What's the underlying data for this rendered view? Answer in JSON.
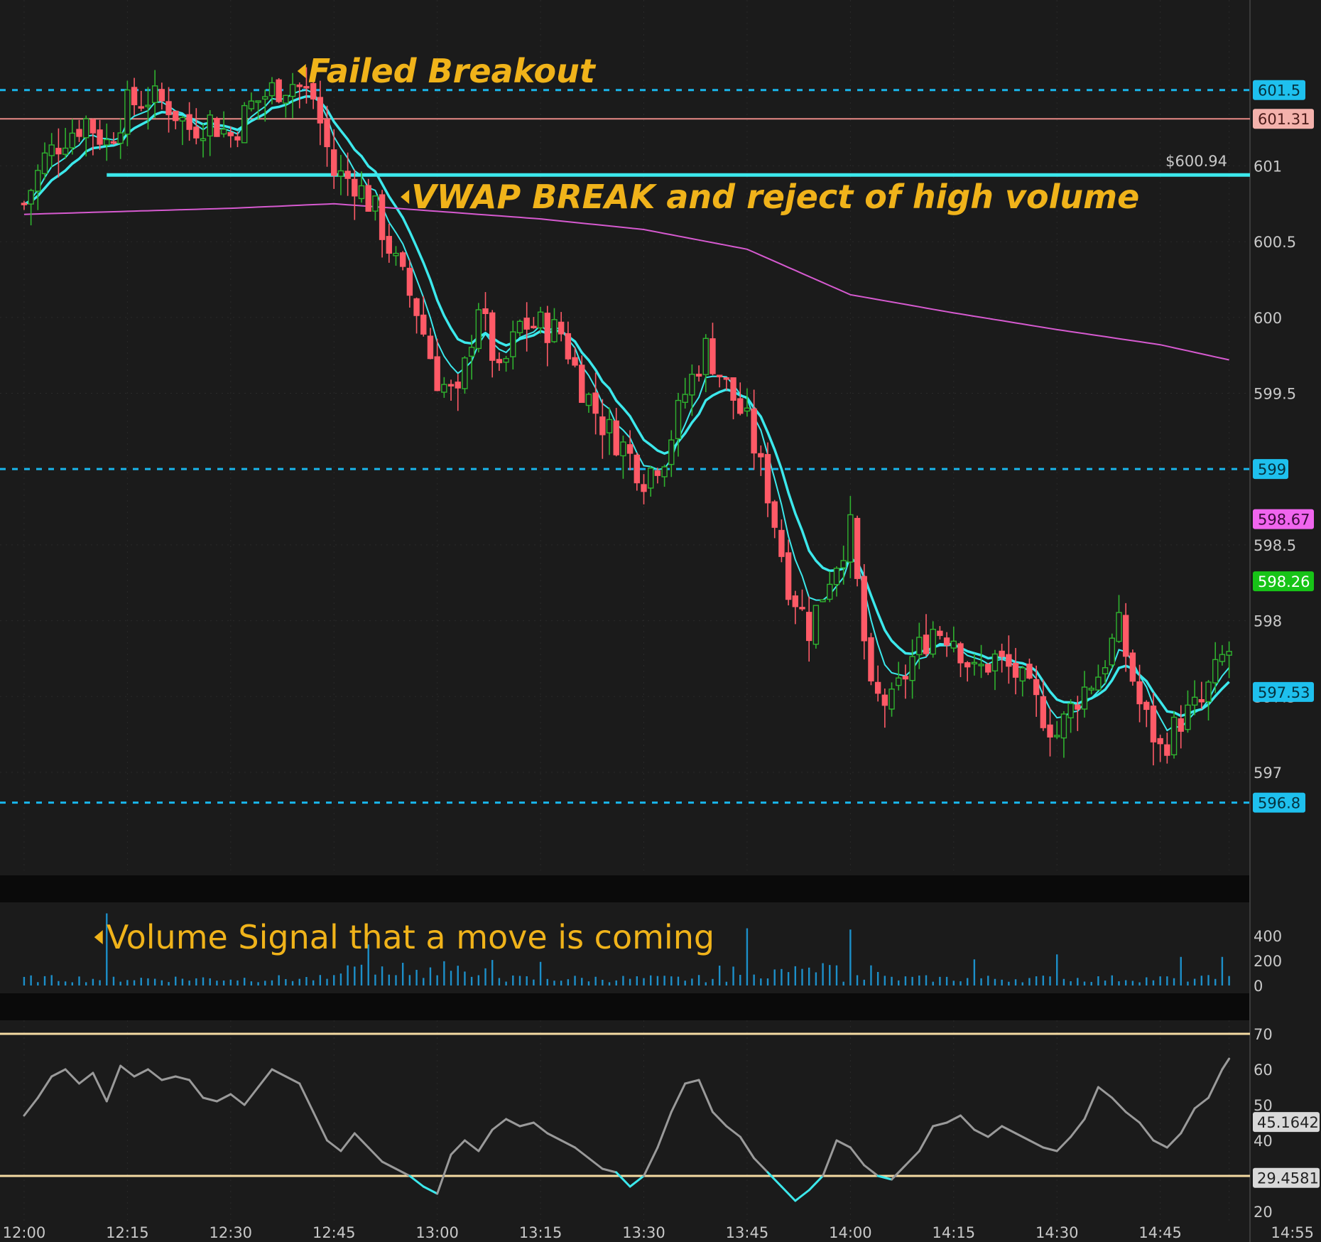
{
  "chart_data": [
    {
      "type": "candlestick",
      "panel": "price",
      "ylim": [
        596.4,
        602.0
      ],
      "y_ticks": [
        "601",
        "600.5",
        "600",
        "599.5",
        "598.5",
        "598",
        "597.5",
        "597"
      ],
      "x_ticks": [
        "12:00",
        "12:15",
        "12:30",
        "12:45",
        "13:00",
        "13:15",
        "13:30",
        "13:45",
        "14:00",
        "14:15",
        "14:30",
        "14:45",
        "14:55"
      ],
      "x_tick_minutes": [
        0,
        15,
        30,
        45,
        60,
        75,
        90,
        105,
        120,
        135,
        150,
        165,
        175
      ],
      "price_levels": [
        {
          "label": "601.5",
          "value": 601.5,
          "style": "dashed",
          "color": "#19b6ec"
        },
        {
          "label": "601.31",
          "value": 601.31,
          "style": "solid",
          "color": "#e98a86"
        },
        {
          "label": "599",
          "value": 599.0,
          "style": "dashed",
          "color": "#19b6ec"
        },
        {
          "label": "596.8",
          "value": 596.8,
          "style": "dashed",
          "color": "#19b6ec"
        }
      ],
      "vwap_line": {
        "label": "$600.94",
        "value": 600.94,
        "color": "#3ce8ec",
        "start_minute": 12
      },
      "price_badges": [
        {
          "label": "598.67",
          "value": 598.67,
          "bg": "#f065ee",
          "fg": "#3a0a3a"
        },
        {
          "label": "598.26",
          "value": 598.26,
          "bg": "#17c317",
          "fg": "#ffffff"
        },
        {
          "label": "597.53",
          "value": 597.53,
          "bg": "#1ec0ee",
          "fg": "#05323f"
        }
      ],
      "annotations": [
        {
          "text": "Failed Breakout",
          "minute": 40,
          "value": 601.55
        },
        {
          "text": "VWAP BREAK and reject of high volume",
          "minute": 55,
          "value": 600.72
        }
      ],
      "close_path": [
        [
          0,
          600.75
        ],
        [
          3,
          601.05
        ],
        [
          6,
          601.2
        ],
        [
          9,
          601.3
        ],
        [
          12,
          601.15
        ],
        [
          15,
          601.4
        ],
        [
          18,
          601.45
        ],
        [
          21,
          601.4
        ],
        [
          24,
          601.25
        ],
        [
          27,
          601.3
        ],
        [
          30,
          601.2
        ],
        [
          33,
          601.4
        ],
        [
          36,
          601.5
        ],
        [
          39,
          601.55
        ],
        [
          42,
          601.45
        ],
        [
          45,
          600.95
        ],
        [
          48,
          600.9
        ],
        [
          51,
          600.7
        ],
        [
          54,
          600.35
        ],
        [
          57,
          600.05
        ],
        [
          60,
          599.6
        ],
        [
          63,
          599.45
        ],
        [
          66,
          600.1
        ],
        [
          69,
          599.6
        ],
        [
          72,
          599.95
        ],
        [
          75,
          599.95
        ],
        [
          78,
          599.9
        ],
        [
          81,
          599.55
        ],
        [
          84,
          599.3
        ],
        [
          87,
          599.15
        ],
        [
          90,
          598.95
        ],
        [
          93,
          599.1
        ],
        [
          96,
          599.5
        ],
        [
          99,
          599.8
        ],
        [
          102,
          599.55
        ],
        [
          105,
          599.3
        ],
        [
          108,
          598.85
        ],
        [
          111,
          598.25
        ],
        [
          114,
          597.95
        ],
        [
          117,
          598.3
        ],
        [
          120,
          598.6
        ],
        [
          123,
          597.5
        ],
        [
          126,
          597.45
        ],
        [
          129,
          597.75
        ],
        [
          132,
          597.95
        ],
        [
          135,
          597.9
        ],
        [
          138,
          597.65
        ],
        [
          141,
          597.75
        ],
        [
          144,
          597.65
        ],
        [
          147,
          597.45
        ],
        [
          150,
          597.25
        ],
        [
          153,
          597.5
        ],
        [
          156,
          597.65
        ],
        [
          159,
          597.95
        ],
        [
          162,
          597.45
        ],
        [
          165,
          597.15
        ],
        [
          168,
          597.35
        ],
        [
          171,
          597.45
        ],
        [
          174,
          597.75
        ],
        [
          175,
          597.8
        ]
      ],
      "ema_fast_color": "#3ce8ec",
      "ema_slow_color": "#3ce8ec",
      "vwap_curve_color": "#d65ad0",
      "vwap_curve": [
        [
          0,
          600.68
        ],
        [
          15,
          600.7
        ],
        [
          30,
          600.72
        ],
        [
          45,
          600.75
        ],
        [
          60,
          600.7
        ],
        [
          75,
          600.65
        ],
        [
          90,
          600.58
        ],
        [
          105,
          600.45
        ],
        [
          120,
          600.15
        ],
        [
          135,
          600.03
        ],
        [
          150,
          599.92
        ],
        [
          165,
          599.82
        ],
        [
          175,
          599.72
        ]
      ]
    },
    {
      "type": "bar",
      "panel": "volume",
      "y_ticks": [
        "400",
        "200",
        "0"
      ],
      "ylim": [
        0,
        600
      ],
      "annotation": "Volume Signal that a move is coming",
      "bar_color": "#1c8fc9",
      "spikes": [
        [
          12,
          580
        ],
        [
          50,
          330
        ],
        [
          75,
          190
        ],
        [
          105,
          460
        ],
        [
          120,
          450
        ],
        [
          138,
          210
        ],
        [
          150,
          250
        ],
        [
          168,
          230
        ],
        [
          174,
          230
        ]
      ]
    },
    {
      "type": "line",
      "panel": "rsi",
      "y_ticks": [
        "70",
        "60",
        "50",
        "40",
        "20"
      ],
      "ylim": [
        18,
        72
      ],
      "overbought": 70,
      "oversold": 30,
      "badges": [
        {
          "label": "45.1642",
          "value": 45.1642
        },
        {
          "label": "29.4581",
          "value": 29.4581
        }
      ],
      "line_color": "#9a9a9a",
      "oversold_color": "#3ce8ec",
      "level_color": "#f5dba3",
      "points": [
        [
          0,
          47
        ],
        [
          2,
          52
        ],
        [
          4,
          58
        ],
        [
          6,
          60
        ],
        [
          8,
          56
        ],
        [
          10,
          59
        ],
        [
          12,
          51
        ],
        [
          14,
          61
        ],
        [
          16,
          58
        ],
        [
          18,
          60
        ],
        [
          20,
          57
        ],
        [
          22,
          58
        ],
        [
          24,
          57
        ],
        [
          26,
          52
        ],
        [
          28,
          51
        ],
        [
          30,
          53
        ],
        [
          32,
          50
        ],
        [
          34,
          55
        ],
        [
          36,
          60
        ],
        [
          38,
          58
        ],
        [
          40,
          56
        ],
        [
          42,
          48
        ],
        [
          44,
          40
        ],
        [
          46,
          37
        ],
        [
          48,
          42
        ],
        [
          50,
          38
        ],
        [
          52,
          34
        ],
        [
          54,
          32
        ],
        [
          56,
          30
        ],
        [
          58,
          27
        ],
        [
          60,
          25
        ],
        [
          62,
          36
        ],
        [
          64,
          40
        ],
        [
          66,
          37
        ],
        [
          68,
          43
        ],
        [
          70,
          46
        ],
        [
          72,
          44
        ],
        [
          74,
          45
        ],
        [
          76,
          42
        ],
        [
          78,
          40
        ],
        [
          80,
          38
        ],
        [
          82,
          35
        ],
        [
          84,
          32
        ],
        [
          86,
          31
        ],
        [
          88,
          27
        ],
        [
          90,
          30
        ],
        [
          92,
          38
        ],
        [
          94,
          48
        ],
        [
          96,
          56
        ],
        [
          98,
          57
        ],
        [
          100,
          48
        ],
        [
          102,
          44
        ],
        [
          104,
          41
        ],
        [
          106,
          35
        ],
        [
          108,
          31
        ],
        [
          110,
          27
        ],
        [
          112,
          23
        ],
        [
          114,
          26
        ],
        [
          116,
          30
        ],
        [
          118,
          40
        ],
        [
          120,
          38
        ],
        [
          122,
          33
        ],
        [
          124,
          30
        ],
        [
          126,
          29
        ],
        [
          128,
          33
        ],
        [
          130,
          37
        ],
        [
          132,
          44
        ],
        [
          134,
          45
        ],
        [
          136,
          47
        ],
        [
          138,
          43
        ],
        [
          140,
          41
        ],
        [
          142,
          44
        ],
        [
          144,
          42
        ],
        [
          146,
          40
        ],
        [
          148,
          38
        ],
        [
          150,
          37
        ],
        [
          152,
          41
        ],
        [
          154,
          46
        ],
        [
          156,
          55
        ],
        [
          158,
          52
        ],
        [
          160,
          48
        ],
        [
          162,
          45
        ],
        [
          164,
          40
        ],
        [
          166,
          38
        ],
        [
          168,
          42
        ],
        [
          170,
          49
        ],
        [
          172,
          52
        ],
        [
          174,
          60
        ],
        [
          175,
          63
        ]
      ]
    }
  ]
}
